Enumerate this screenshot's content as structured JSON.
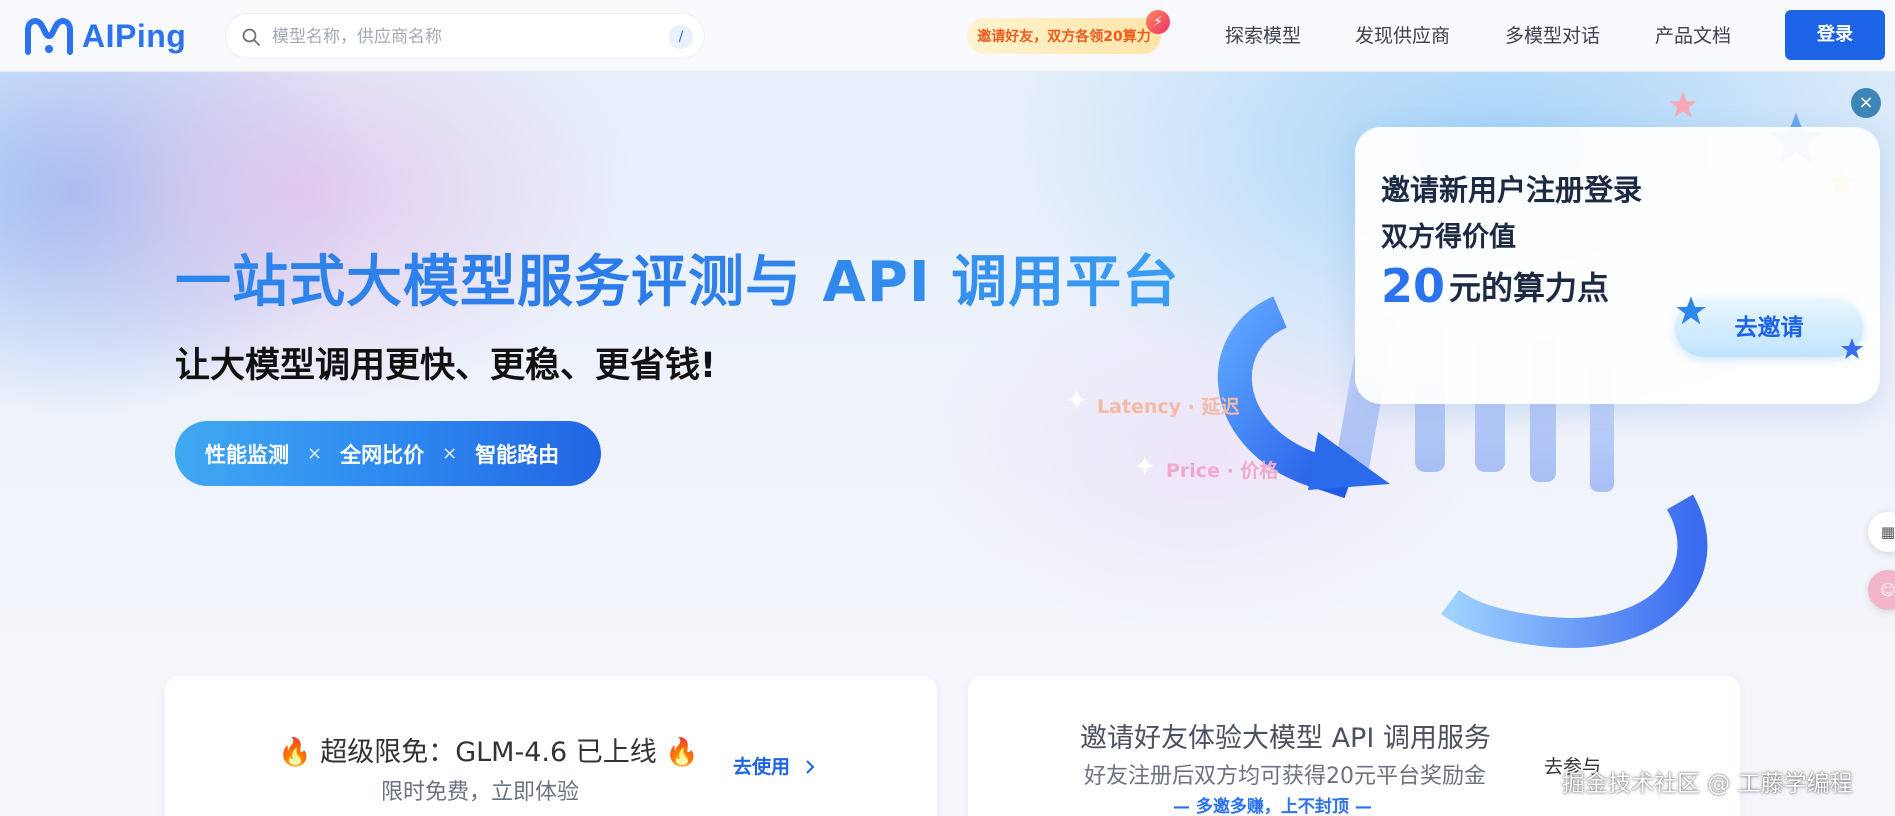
{
  "header": {
    "logo_text": "AIPing",
    "search_placeholder": "模型名称，供应商名称",
    "search_shortcut": "/",
    "invite_badge": "邀请好友，双方各领20算力",
    "nav": [
      "探索模型",
      "发现供应商",
      "多模型对话",
      "产品文档"
    ],
    "login_label": "登录"
  },
  "hero": {
    "title": "一站式大模型服务评测与 API 调用平台",
    "subtitle": "让大模型调用更快、更稳、更省钱!",
    "features": [
      "性能监测",
      "全网比价",
      "智能路由"
    ],
    "feature_separator": "×",
    "tag_latency": "Latency · 延迟",
    "tag_price": "Price · 价格"
  },
  "popup": {
    "line1": "邀请新用户注册登录",
    "line2": "双方得价值",
    "amount": "20",
    "amount_unit": "元的算力点",
    "button": "去邀请",
    "close": "×"
  },
  "cards": {
    "card1": {
      "title": "🔥 超级限免：GLM-4.6 已上线 🔥",
      "subtitle": "限时免费，立即体验",
      "link": "去使用"
    },
    "card2": {
      "title": "邀请好友体验大模型 API 调用服务",
      "subtitle": "好友注册后双方均可获得20元平台奖励金",
      "tag": "—  多邀多赚，上不封顶  —",
      "link": "去参与"
    }
  },
  "watermark": "掘金技术社区 @ 工藤学编程",
  "colors": {
    "brand": "#2a72ee",
    "login_button": "#1d63e6",
    "invite_text": "#f05a1a"
  }
}
